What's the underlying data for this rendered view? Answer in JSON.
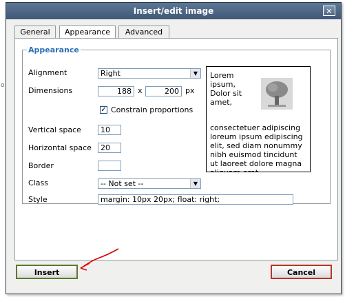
{
  "dialog": {
    "title": "Insert/edit image",
    "close_label": "✕"
  },
  "background": {
    "edge_letter": "o"
  },
  "tabs": [
    {
      "label": "General",
      "active": false
    },
    {
      "label": "Appearance",
      "active": true
    },
    {
      "label": "Advanced",
      "active": false
    }
  ],
  "appearance": {
    "legend": "Appearance",
    "alignment": {
      "label": "Alignment",
      "value": "Right"
    },
    "dimensions": {
      "label": "Dimensions",
      "width": "188",
      "separator": "x",
      "height": "200",
      "unit": "px"
    },
    "constrain": {
      "label": "Constrain proportions",
      "checked": true
    },
    "vertical_space": {
      "label": "Vertical space",
      "value": "10"
    },
    "horizontal_space": {
      "label": "Horizontal space",
      "value": "20"
    },
    "border": {
      "label": "Border",
      "value": ""
    },
    "class": {
      "label": "Class",
      "value": "-- Not set --"
    },
    "style": {
      "label": "Style",
      "value": "margin: 10px 20px; float: right;"
    }
  },
  "preview": {
    "text": "Lorem ipsum, Dolor sit amet, consectetuer adipiscing loreum ipsum edipiscing elit, sed diam nonummy nibh euismod tincidunt ut laoreet dolore magna aliquam erat volutpat.Loreum ipsum edipiscing, sed diam nonummy nibh euismod tincidunt ut laoreet dolore magna aliquam erat volutpat."
  },
  "buttons": {
    "insert": "Insert",
    "cancel": "Cancel"
  },
  "colors": {
    "titlebar": "#4a6381",
    "legend": "#2b6fb6",
    "insert_border": "#5a7a2e",
    "cancel_border": "#b7342a",
    "annotation": "#dd0000"
  },
  "icons": {
    "close": "close-icon",
    "dropdown": "chevron-down-icon",
    "check": "checkmark-icon",
    "image": "tree-image-icon",
    "annotation": "red-arrow-annotation"
  }
}
